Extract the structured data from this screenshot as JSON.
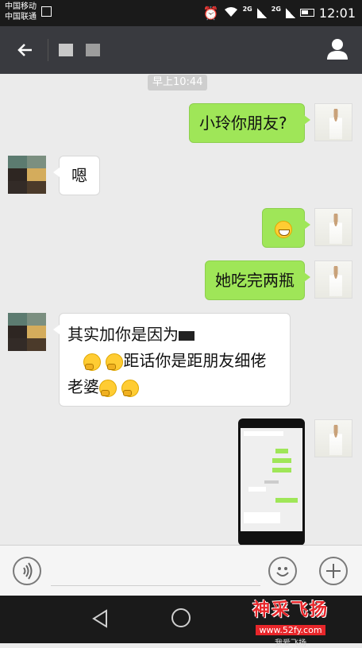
{
  "status_bar": {
    "carrier1": "中国移动",
    "carrier2": "中国联通",
    "net1": "2G",
    "net2": "2G",
    "time": "12:01"
  },
  "header": {
    "back_icon": "arrow-left-icon",
    "contact_icon": "person-icon"
  },
  "chat": {
    "timestamp": "早上10:44",
    "messages": [
      {
        "side": "out",
        "text": "小玲你朋友?"
      },
      {
        "side": "in",
        "text": "嗯"
      },
      {
        "side": "out",
        "emoji": "grin-emoji"
      },
      {
        "side": "out",
        "text": "她吃完两瓶"
      },
      {
        "side": "in",
        "line1": "其实加你是因为",
        "line2": "距话你是距朋友细佬",
        "line3": "老婆"
      }
    ]
  },
  "input_bar": {
    "voice_icon": "voice-icon",
    "emoji_icon": "emoji-icon",
    "plus_icon": "plus-icon"
  },
  "watermark": {
    "main": "神采飞扬",
    "url": "www.52fy.com",
    "sub": "我爱飞扬"
  },
  "colors": {
    "out_bubble": "#9fe658",
    "title_bar": "#393a3f",
    "chat_bg": "#ebebeb"
  }
}
